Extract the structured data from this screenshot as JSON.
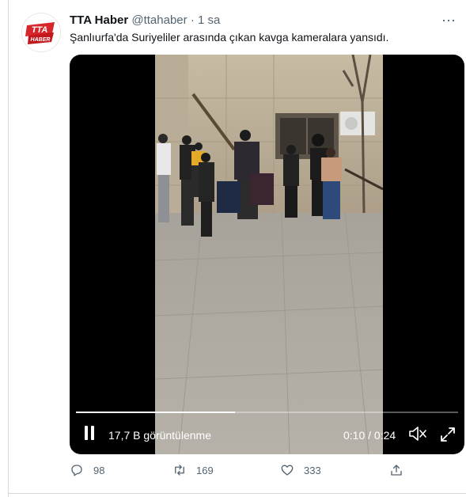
{
  "tweet": {
    "name": "TTA Haber",
    "handle": "@ttahaber",
    "separator": "·",
    "time": "1 sa",
    "text": "Şanlıurfa'da Suriyeliler arasında çıkan kavga kameralara yansıdı.",
    "avatar_text_top": "TTA",
    "avatar_text_bottom": "HABER"
  },
  "video": {
    "views": "17,7 B görüntülenme",
    "timecode": "0:10 / 0:24",
    "progress": 0.4167
  },
  "actions": {
    "reply_count": "98",
    "retweet_count": "169",
    "like_count": "333"
  },
  "colors": {
    "accent_red": "#d7262b",
    "muted_text": "#536471"
  },
  "icons": [
    "more-icon",
    "pause-icon",
    "mute-icon",
    "fullscreen-icon",
    "reply-icon",
    "retweet-icon",
    "like-icon",
    "share-icon"
  ]
}
